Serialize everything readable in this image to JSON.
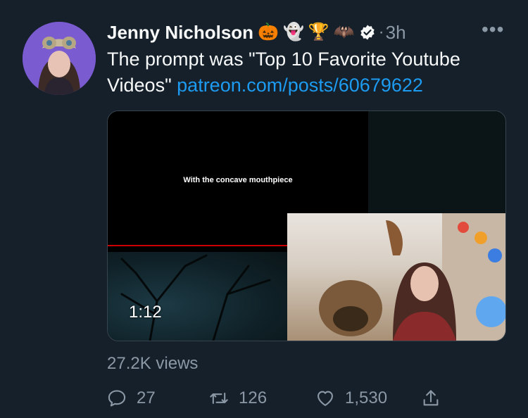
{
  "author": {
    "name": "Jenny Nicholson",
    "emojis": [
      "🎃",
      "👻",
      "🏆",
      "🦇"
    ],
    "verified": true,
    "separator": "·",
    "time": "3h"
  },
  "tweet": {
    "text": "The prompt was \"Top 10 Favorite Youtube Videos\" ",
    "link": "patreon.com/posts/60679622"
  },
  "media": {
    "caption": "With the concave mouthpiece",
    "duration": "1:12",
    "views": "27.2K views"
  },
  "actions": {
    "replies": "27",
    "retweets": "126",
    "likes": "1,530"
  },
  "more_label": "•••",
  "colors": {
    "background": "#15202b",
    "secondary_text": "#8b98a5",
    "link": "#1d9bf0",
    "avatar_bg": "#7a5bd0"
  }
}
